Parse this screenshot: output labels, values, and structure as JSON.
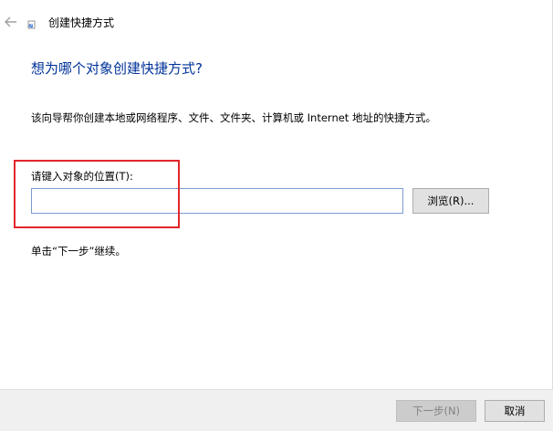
{
  "window": {
    "title": "创建快捷方式",
    "back_icon": "back-arrow-icon",
    "app_icon": "shortcut-icon"
  },
  "main": {
    "heading": "想为哪个对象创建快捷方式?",
    "description": "该向导帮你创建本地或网络程序、文件、文件夹、计算机或 Internet 地址的快捷方式。",
    "location_label": "请键入对象的位置(T):",
    "location_value": "",
    "browse_label": "浏览(R)...",
    "continue_hint": "单击“下一步”继续。"
  },
  "footer": {
    "next_label": "下一步(N)",
    "cancel_label": "取消",
    "next_enabled": false
  },
  "colors": {
    "heading": "#003399",
    "highlight": "#e2262b",
    "input_border": "#7a9bd0",
    "footer_bg": "#f0f0f0"
  }
}
